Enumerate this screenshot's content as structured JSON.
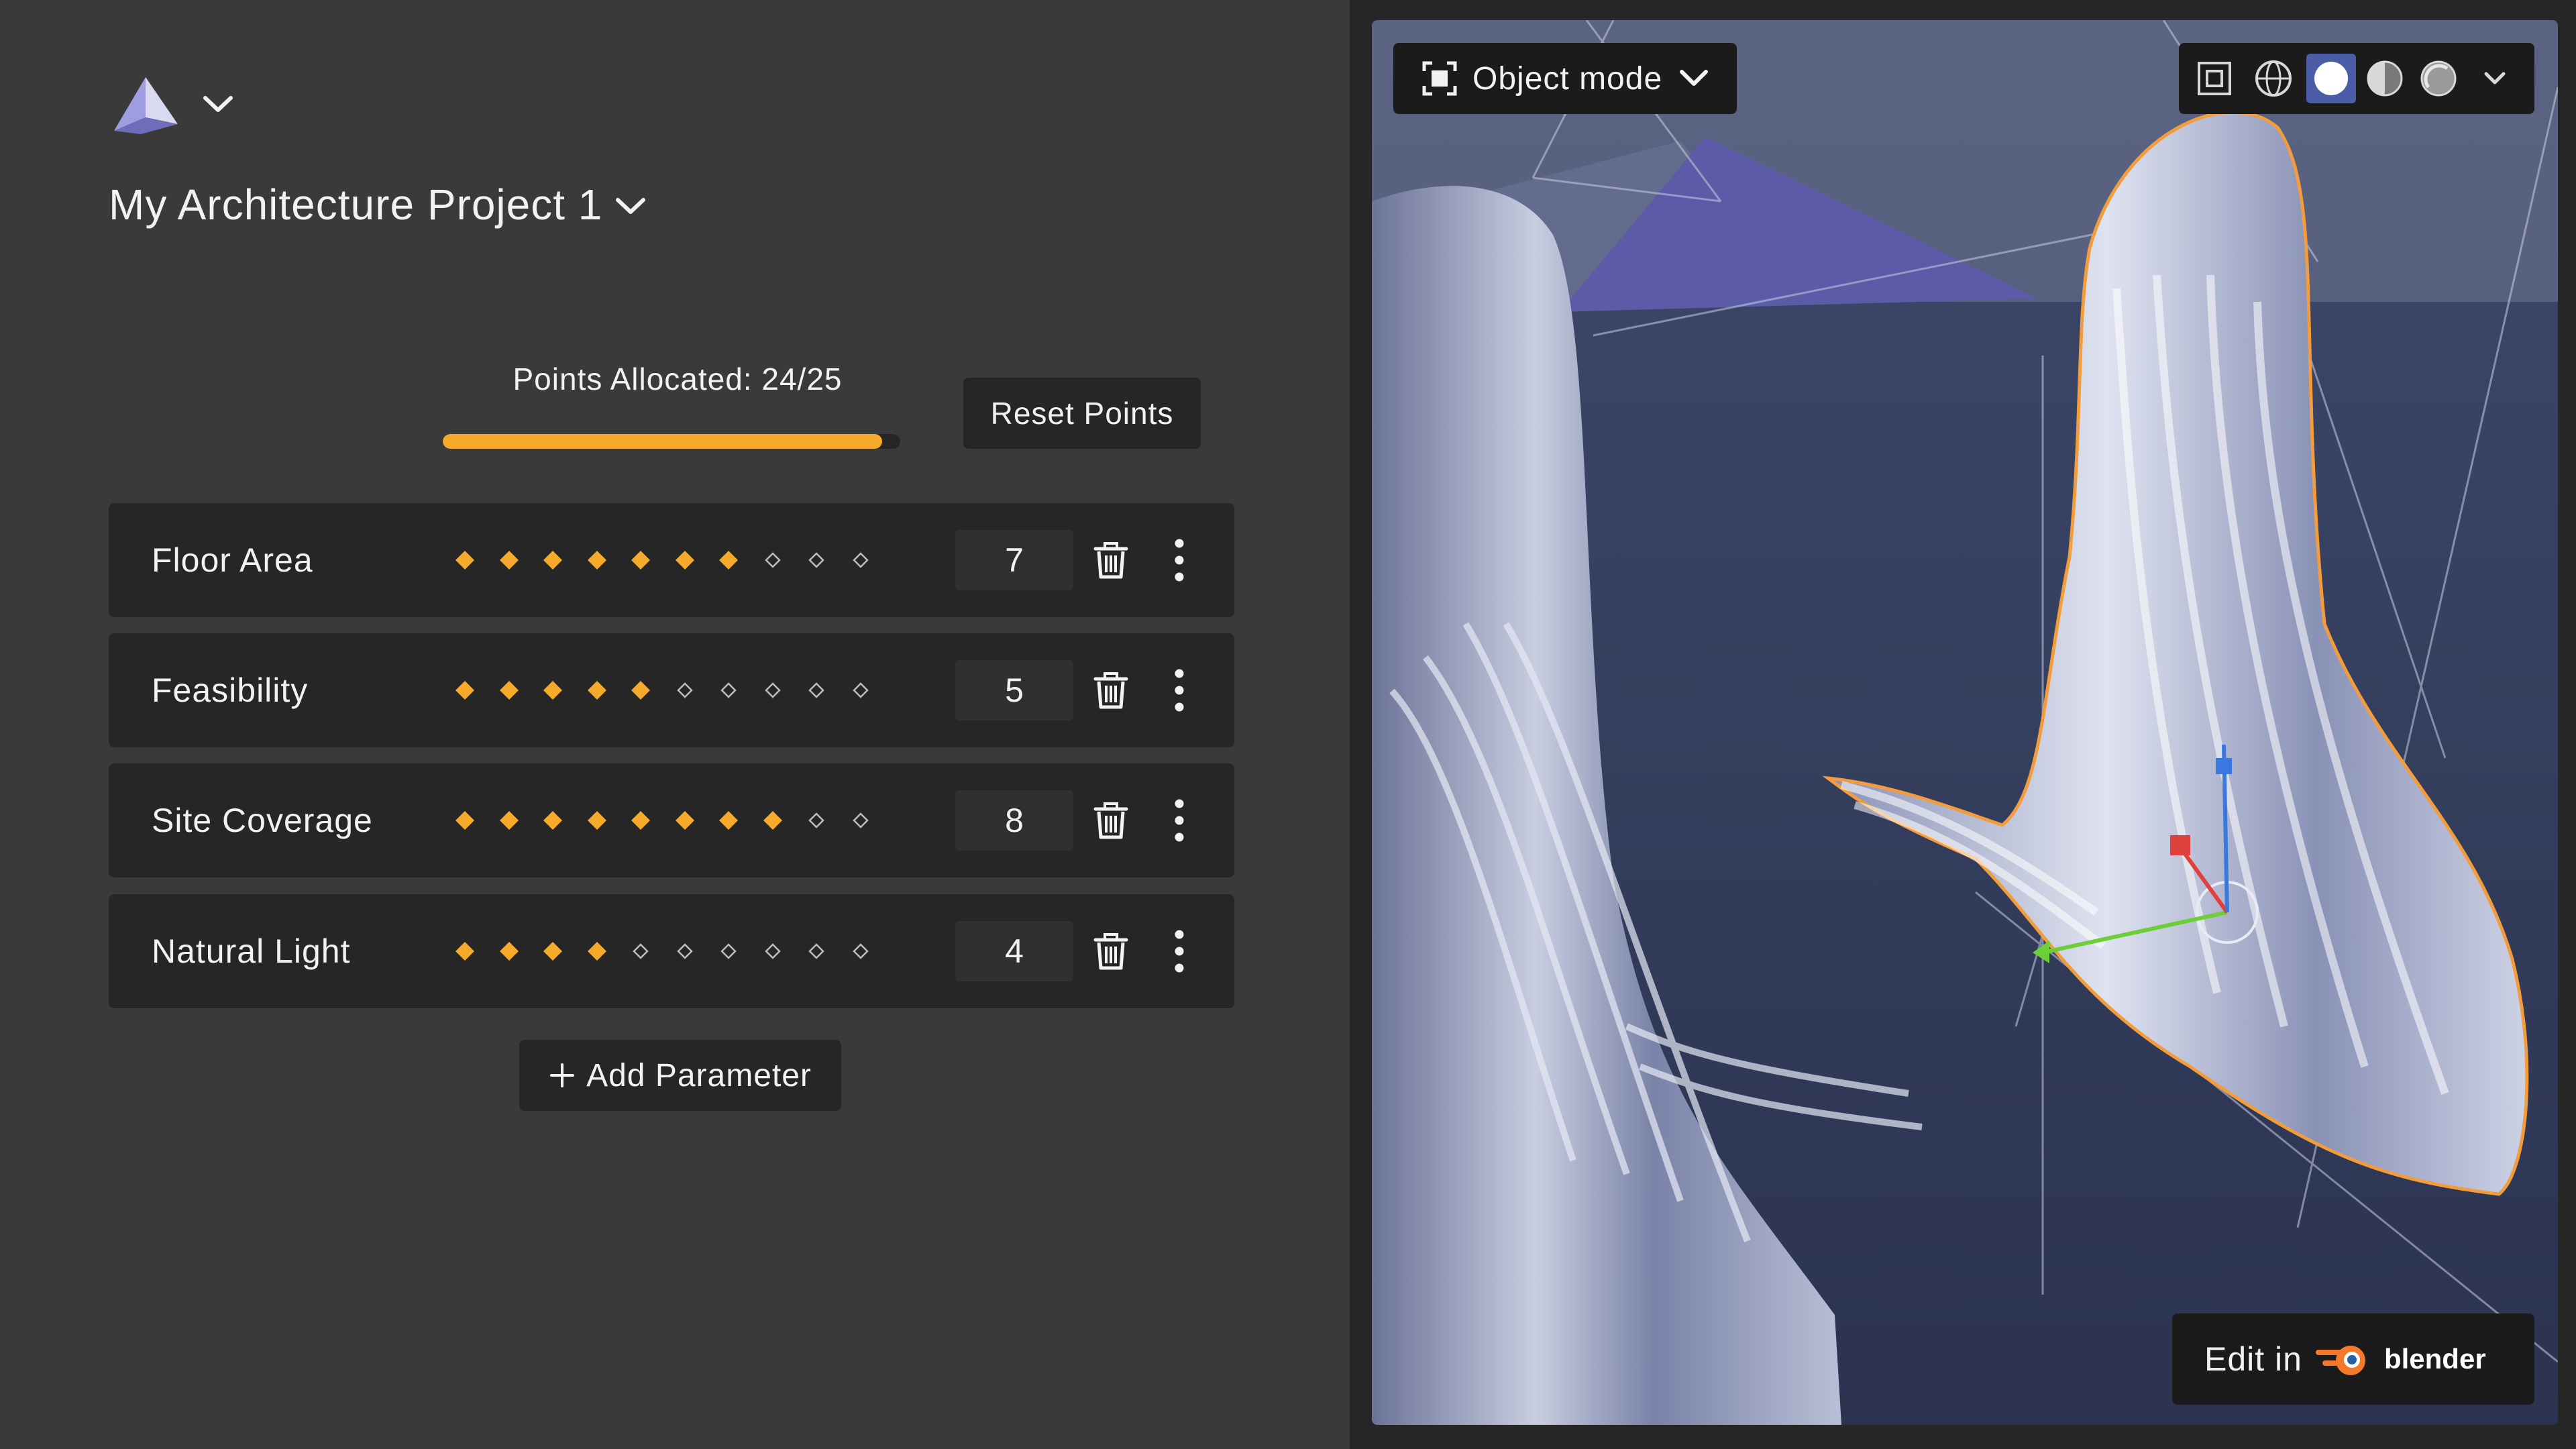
{
  "project": {
    "title": "My Architecture Project 1"
  },
  "points": {
    "label": "Points Allocated: 24/25",
    "allocated": 24,
    "total": 25
  },
  "reset_button": {
    "label": "Reset Points"
  },
  "parameters": [
    {
      "name": "Floor Area",
      "value": "7",
      "filled": 7,
      "max": 10
    },
    {
      "name": "Feasibility",
      "value": "5",
      "filled": 5,
      "max": 10
    },
    {
      "name": "Site Coverage",
      "value": "8",
      "filled": 8,
      "max": 10
    },
    {
      "name": "Natural Light",
      "value": "4",
      "filled": 4,
      "max": 10
    }
  ],
  "add_button": {
    "label": "Add Parameter"
  },
  "viewport": {
    "mode_label": "Object mode",
    "edit_label": "Edit in",
    "blender_label": "blender",
    "shading_modes": [
      "wireframe-icon",
      "solid-icon",
      "material-preview-icon",
      "rendered-icon"
    ],
    "active_shading": "solid-icon"
  },
  "colors": {
    "accent": "#f5aa2c",
    "panel": "#3a3a3a",
    "row": "#262626",
    "blender_orange": "#f5792a",
    "logo_blue": "#8a8ad4"
  },
  "icons": [
    "logo-pyramid-icon",
    "chevron-down-icon",
    "trash-icon",
    "more-vertical-icon",
    "plus-icon",
    "object-mode-icon",
    "overlay-icon",
    "blender-logo-icon"
  ]
}
